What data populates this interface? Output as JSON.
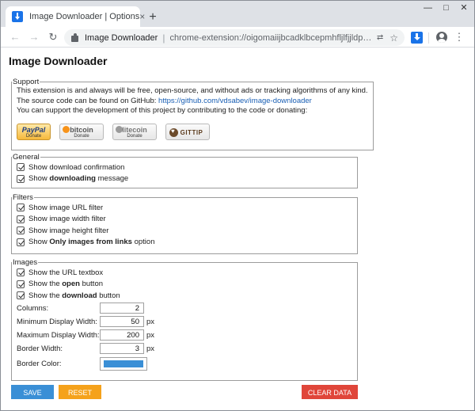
{
  "tab": {
    "title": "Image Downloader | Options",
    "close": "×",
    "new_tab": "+"
  },
  "window_controls": {
    "minimize": "—",
    "maximize": "□",
    "close": "✕"
  },
  "toolbar": {
    "back": "←",
    "forward": "→",
    "reload": "↻",
    "site_name": "Image Downloader",
    "separator": "|",
    "url": "chrome-extension://oigomaiijbcadklbcepmhfljlfjjldpc/...",
    "translate": "⇄",
    "star": "☆",
    "menu": "⋮"
  },
  "page": {
    "title": "Image Downloader",
    "support": {
      "legend": "Support",
      "line1": "This extension is and always will be free, open-source, and without ads or tracking algorithms of any kind.",
      "line2_prefix": "The source code can be found on GitHub: ",
      "line2_link": "https://github.com/vdsabev/image-downloader",
      "line3": "You can support the development of this project by contributing to the code or donating:",
      "donate": {
        "paypal": {
          "brand": "PayPal",
          "sub": "Donate"
        },
        "bitcoin": {
          "brand": "bitcoin",
          "sub": "Donate"
        },
        "litecoin": {
          "brand": "litecoin",
          "sub": "Donate"
        },
        "gittip": {
          "brand": "GITTIP"
        }
      }
    },
    "general": {
      "legend": "General",
      "items": [
        {
          "label": "Show download confirmation",
          "checked": true
        },
        {
          "label_pre": "Show ",
          "label_bold": "downloading",
          "label_post": " message",
          "checked": true
        }
      ]
    },
    "filters": {
      "legend": "Filters",
      "items": [
        {
          "label": "Show image URL filter",
          "checked": true
        },
        {
          "label": "Show image width filter",
          "checked": true
        },
        {
          "label": "Show image height filter",
          "checked": true
        },
        {
          "label_pre": "Show ",
          "label_bold": "Only images from links",
          "label_post": " option",
          "checked": true
        }
      ]
    },
    "images": {
      "legend": "Images",
      "checks": [
        {
          "label": "Show the URL textbox",
          "checked": true
        },
        {
          "label_pre": "Show the ",
          "label_bold": "open",
          "label_post": " button",
          "checked": true
        },
        {
          "label_pre": "Show the ",
          "label_bold": "download",
          "label_post": " button",
          "checked": true
        }
      ],
      "columns": {
        "label": "Columns:",
        "value": "2"
      },
      "min_width": {
        "label": "Minimum Display Width:",
        "value": "50",
        "unit": "px"
      },
      "max_width": {
        "label": "Maximum Display Width:",
        "value": "200",
        "unit": "px"
      },
      "border_width": {
        "label": "Border Width:",
        "value": "3",
        "unit": "px"
      },
      "border_color": {
        "label": "Border Color:",
        "value": "#3a8fd6"
      }
    },
    "buttons": {
      "save": "SAVE",
      "reset": "RESET",
      "clear": "CLEAR DATA"
    }
  },
  "colors": {
    "save_button": "#3a8fd6",
    "reset_button": "#f5a21b",
    "clear_button": "#e0463a",
    "link": "#1a5fb4",
    "extension_icon": "#1a73e8"
  }
}
